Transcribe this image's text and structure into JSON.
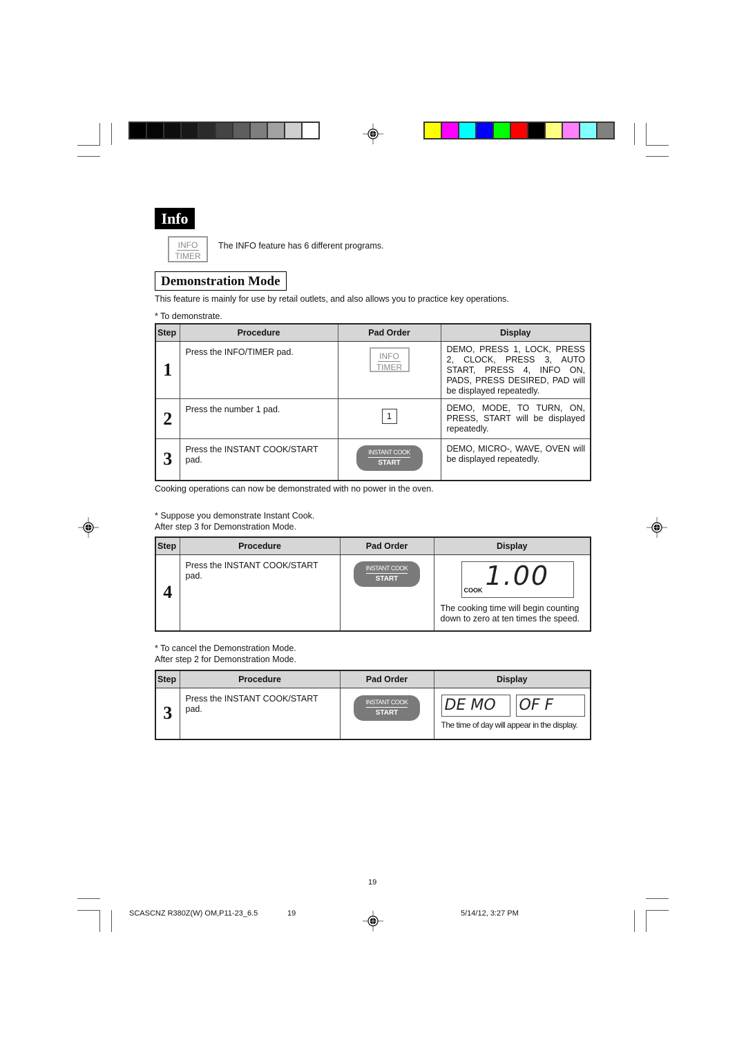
{
  "printer_marks": {
    "grayscale_swatches": [
      "#000000",
      "#050505",
      "#0d0d0d",
      "#181818",
      "#2b2b2b",
      "#444444",
      "#5e5e5e",
      "#7e7e7e",
      "#a2a2a2",
      "#cfcfcf",
      "#ffffff"
    ],
    "color_swatches": [
      "#ffff00",
      "#ff00ff",
      "#00ffff",
      "#0000ff",
      "#00ff00",
      "#ff0000",
      "#000000",
      "#ffff80",
      "#ff80ff",
      "#80ffff",
      "#808080"
    ]
  },
  "info": {
    "heading": "Info",
    "pad_top": "INFO",
    "pad_bottom": "TIMER",
    "description": "The INFO feature has 6 different programs."
  },
  "demo": {
    "title": "Demonstration Mode",
    "intro": "This feature is mainly for use by retail outlets, and also allows you to practice key operations.",
    "to_demonstrate": "* To demonstrate.",
    "headers": {
      "step": "Step",
      "procedure": "Procedure",
      "pad_order": "Pad Order",
      "display": "Display"
    },
    "table1": [
      {
        "step": "1",
        "procedure": "Press the INFO/TIMER pad.",
        "pad": "info-timer",
        "display": "DEMO, PRESS 1, LOCK, PRESS 2, CLOCK, PRESS 3, AUTO START, PRESS 4, INFO ON, PADS, PRESS DESIRED, PAD will be displayed repeatedly."
      },
      {
        "step": "2",
        "procedure": "Press the number 1 pad.",
        "pad": "1",
        "display": "DEMO, MODE, TO TURN, ON, PRESS, START will be displayed repeatedly."
      },
      {
        "step": "3",
        "procedure": "Press the INSTANT COOK/START pad.",
        "pad": "instant-cook-start",
        "display": "DEMO, MICRO-, WAVE, OVEN will be displayed repeatedly."
      }
    ],
    "after_table1": "Cooking operations can now be demonstrated with no power in the oven.",
    "suppose_line1": "* Suppose you demonstrate Instant Cook.",
    "suppose_line2": "After step 3 for Demonstration Mode.",
    "table2": [
      {
        "step": "4",
        "procedure": "Press the INSTANT COOK/START pad.",
        "lcd_value": "1.00",
        "lcd_label": "COOK",
        "display": "The cooking time will begin counting down to zero at ten times the speed."
      }
    ],
    "cancel_line1": "* To cancel the Demonstration Mode.",
    "cancel_line2": "After step 2 for Demonstration Mode.",
    "table3": [
      {
        "step": "3",
        "procedure": "Press the INSTANT COOK/START pad.",
        "lcd1": "DE MO",
        "lcd2": "OF F",
        "display": "The time of day will appear in the display."
      }
    ],
    "button": {
      "top": "INSTANT COOK",
      "bottom": "START"
    },
    "number_pad": "1"
  },
  "footer": {
    "page_number": "19",
    "file_name": "SCASCNZ R380Z(W) OM,P11-23_6.5",
    "file_page": "19",
    "timestamp": "5/14/12, 3:27 PM"
  }
}
